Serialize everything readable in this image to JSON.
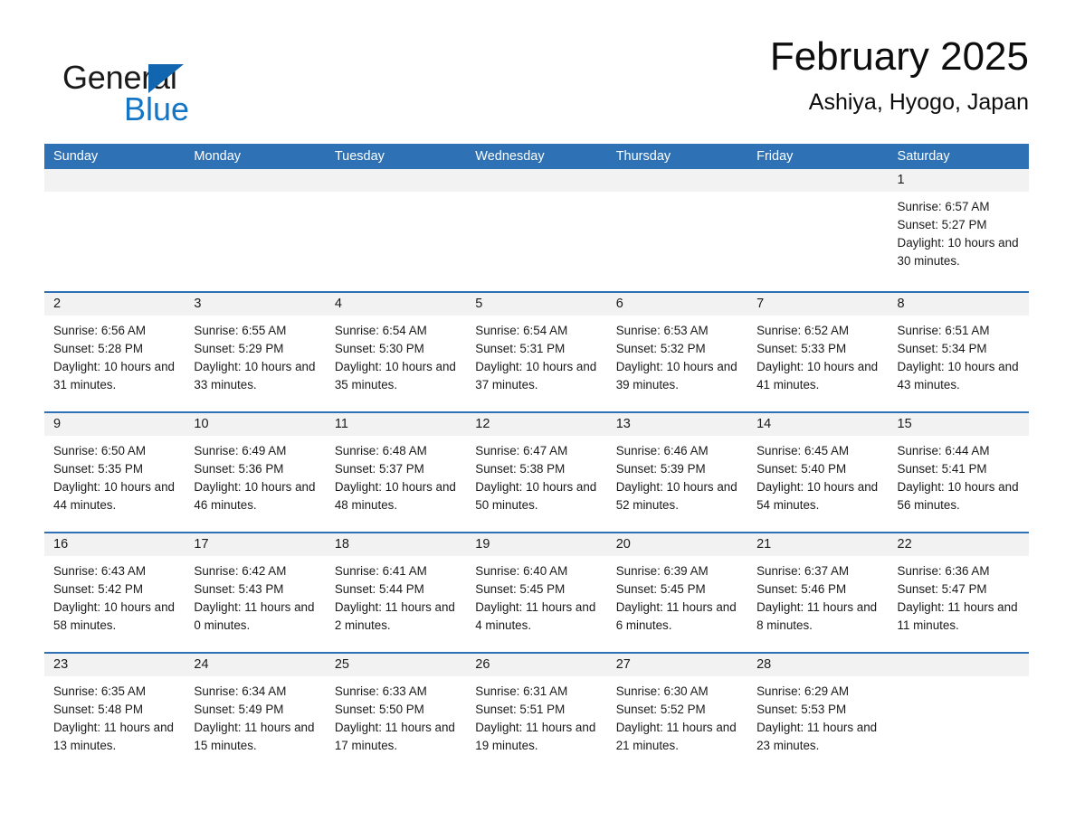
{
  "brand": {
    "name_dark": "General",
    "name_light": "Blue",
    "triangle_color": "#1266b0",
    "blue_color": "#1475c4"
  },
  "header": {
    "title": "February 2025",
    "subtitle": "Ashiya, Hyogo, Japan"
  },
  "theme": {
    "header_blue": "#2e71b4",
    "day_band_gray": "#f2f2f2",
    "text": "#1a1a1a"
  },
  "weekdays": [
    "Sunday",
    "Monday",
    "Tuesday",
    "Wednesday",
    "Thursday",
    "Friday",
    "Saturday"
  ],
  "weeks": [
    [
      {
        "date": "",
        "sunrise": "",
        "sunset": "",
        "daylight": ""
      },
      {
        "date": "",
        "sunrise": "",
        "sunset": "",
        "daylight": ""
      },
      {
        "date": "",
        "sunrise": "",
        "sunset": "",
        "daylight": ""
      },
      {
        "date": "",
        "sunrise": "",
        "sunset": "",
        "daylight": ""
      },
      {
        "date": "",
        "sunrise": "",
        "sunset": "",
        "daylight": ""
      },
      {
        "date": "",
        "sunrise": "",
        "sunset": "",
        "daylight": ""
      },
      {
        "date": "1",
        "sunrise": "Sunrise: 6:57 AM",
        "sunset": "Sunset: 5:27 PM",
        "daylight": "Daylight: 10 hours and 30 minutes."
      }
    ],
    [
      {
        "date": "2",
        "sunrise": "Sunrise: 6:56 AM",
        "sunset": "Sunset: 5:28 PM",
        "daylight": "Daylight: 10 hours and 31 minutes."
      },
      {
        "date": "3",
        "sunrise": "Sunrise: 6:55 AM",
        "sunset": "Sunset: 5:29 PM",
        "daylight": "Daylight: 10 hours and 33 minutes."
      },
      {
        "date": "4",
        "sunrise": "Sunrise: 6:54 AM",
        "sunset": "Sunset: 5:30 PM",
        "daylight": "Daylight: 10 hours and 35 minutes."
      },
      {
        "date": "5",
        "sunrise": "Sunrise: 6:54 AM",
        "sunset": "Sunset: 5:31 PM",
        "daylight": "Daylight: 10 hours and 37 minutes."
      },
      {
        "date": "6",
        "sunrise": "Sunrise: 6:53 AM",
        "sunset": "Sunset: 5:32 PM",
        "daylight": "Daylight: 10 hours and 39 minutes."
      },
      {
        "date": "7",
        "sunrise": "Sunrise: 6:52 AM",
        "sunset": "Sunset: 5:33 PM",
        "daylight": "Daylight: 10 hours and 41 minutes."
      },
      {
        "date": "8",
        "sunrise": "Sunrise: 6:51 AM",
        "sunset": "Sunset: 5:34 PM",
        "daylight": "Daylight: 10 hours and 43 minutes."
      }
    ],
    [
      {
        "date": "9",
        "sunrise": "Sunrise: 6:50 AM",
        "sunset": "Sunset: 5:35 PM",
        "daylight": "Daylight: 10 hours and 44 minutes."
      },
      {
        "date": "10",
        "sunrise": "Sunrise: 6:49 AM",
        "sunset": "Sunset: 5:36 PM",
        "daylight": "Daylight: 10 hours and 46 minutes."
      },
      {
        "date": "11",
        "sunrise": "Sunrise: 6:48 AM",
        "sunset": "Sunset: 5:37 PM",
        "daylight": "Daylight: 10 hours and 48 minutes."
      },
      {
        "date": "12",
        "sunrise": "Sunrise: 6:47 AM",
        "sunset": "Sunset: 5:38 PM",
        "daylight": "Daylight: 10 hours and 50 minutes."
      },
      {
        "date": "13",
        "sunrise": "Sunrise: 6:46 AM",
        "sunset": "Sunset: 5:39 PM",
        "daylight": "Daylight: 10 hours and 52 minutes."
      },
      {
        "date": "14",
        "sunrise": "Sunrise: 6:45 AM",
        "sunset": "Sunset: 5:40 PM",
        "daylight": "Daylight: 10 hours and 54 minutes."
      },
      {
        "date": "15",
        "sunrise": "Sunrise: 6:44 AM",
        "sunset": "Sunset: 5:41 PM",
        "daylight": "Daylight: 10 hours and 56 minutes."
      }
    ],
    [
      {
        "date": "16",
        "sunrise": "Sunrise: 6:43 AM",
        "sunset": "Sunset: 5:42 PM",
        "daylight": "Daylight: 10 hours and 58 minutes."
      },
      {
        "date": "17",
        "sunrise": "Sunrise: 6:42 AM",
        "sunset": "Sunset: 5:43 PM",
        "daylight": "Daylight: 11 hours and 0 minutes."
      },
      {
        "date": "18",
        "sunrise": "Sunrise: 6:41 AM",
        "sunset": "Sunset: 5:44 PM",
        "daylight": "Daylight: 11 hours and 2 minutes."
      },
      {
        "date": "19",
        "sunrise": "Sunrise: 6:40 AM",
        "sunset": "Sunset: 5:45 PM",
        "daylight": "Daylight: 11 hours and 4 minutes."
      },
      {
        "date": "20",
        "sunrise": "Sunrise: 6:39 AM",
        "sunset": "Sunset: 5:45 PM",
        "daylight": "Daylight: 11 hours and 6 minutes."
      },
      {
        "date": "21",
        "sunrise": "Sunrise: 6:37 AM",
        "sunset": "Sunset: 5:46 PM",
        "daylight": "Daylight: 11 hours and 8 minutes."
      },
      {
        "date": "22",
        "sunrise": "Sunrise: 6:36 AM",
        "sunset": "Sunset: 5:47 PM",
        "daylight": "Daylight: 11 hours and 11 minutes."
      }
    ],
    [
      {
        "date": "23",
        "sunrise": "Sunrise: 6:35 AM",
        "sunset": "Sunset: 5:48 PM",
        "daylight": "Daylight: 11 hours and 13 minutes."
      },
      {
        "date": "24",
        "sunrise": "Sunrise: 6:34 AM",
        "sunset": "Sunset: 5:49 PM",
        "daylight": "Daylight: 11 hours and 15 minutes."
      },
      {
        "date": "25",
        "sunrise": "Sunrise: 6:33 AM",
        "sunset": "Sunset: 5:50 PM",
        "daylight": "Daylight: 11 hours and 17 minutes."
      },
      {
        "date": "26",
        "sunrise": "Sunrise: 6:31 AM",
        "sunset": "Sunset: 5:51 PM",
        "daylight": "Daylight: 11 hours and 19 minutes."
      },
      {
        "date": "27",
        "sunrise": "Sunrise: 6:30 AM",
        "sunset": "Sunset: 5:52 PM",
        "daylight": "Daylight: 11 hours and 21 minutes."
      },
      {
        "date": "28",
        "sunrise": "Sunrise: 6:29 AM",
        "sunset": "Sunset: 5:53 PM",
        "daylight": "Daylight: 11 hours and 23 minutes."
      },
      {
        "date": "",
        "sunrise": "",
        "sunset": "",
        "daylight": ""
      }
    ]
  ]
}
